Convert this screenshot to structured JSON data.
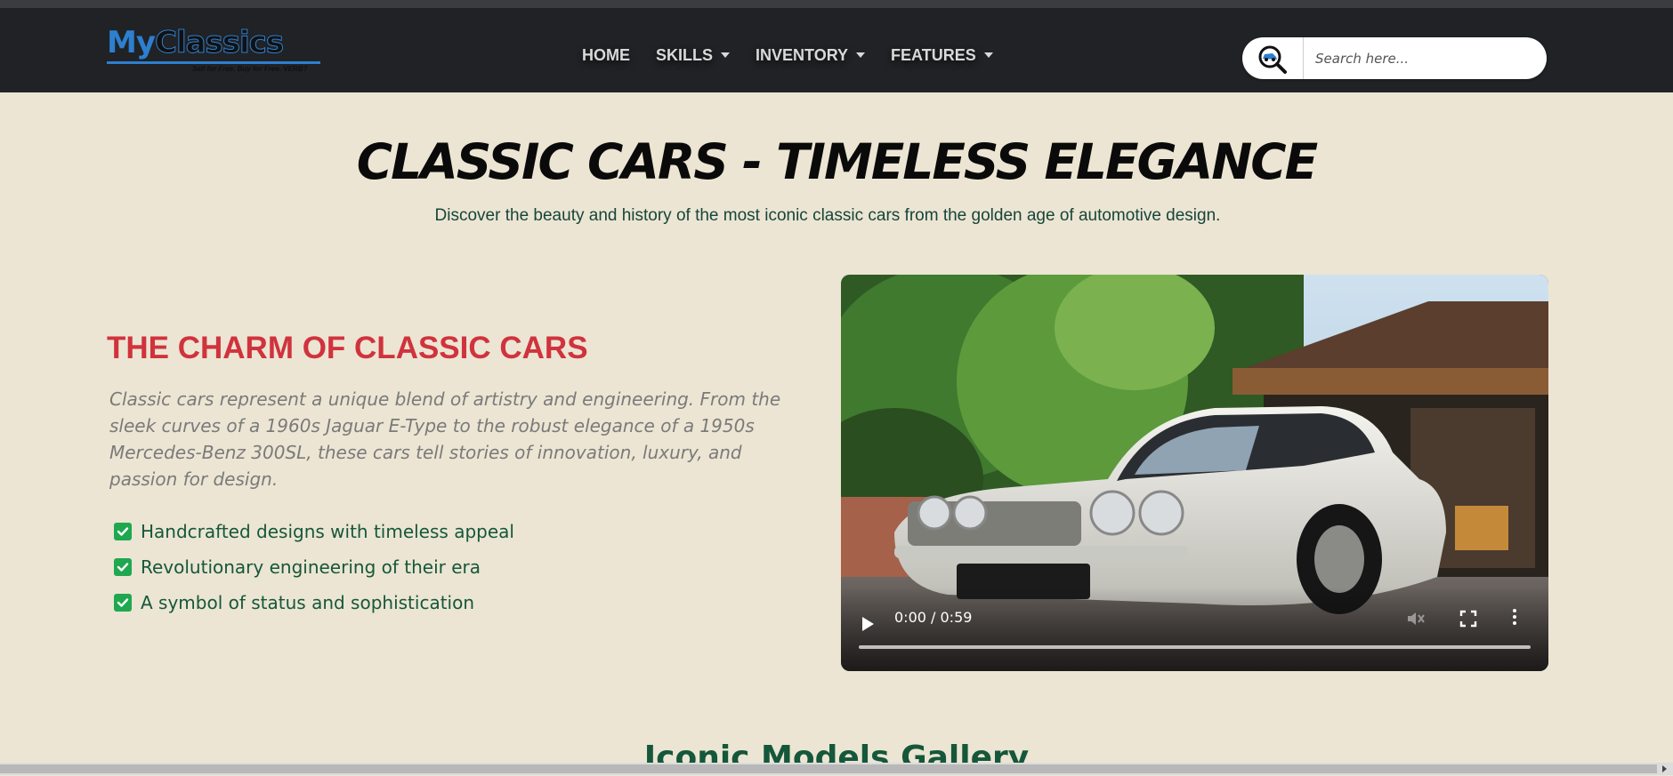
{
  "brand": {
    "name_part1": "My",
    "name_part2": "Classics",
    "tagline": "Sell for Free. Buy for Free. VERB?"
  },
  "nav": {
    "items": [
      {
        "label": "HOME",
        "has_dropdown": false
      },
      {
        "label": "SKILLS",
        "has_dropdown": true
      },
      {
        "label": "INVENTORY",
        "has_dropdown": true
      },
      {
        "label": "FEATURES",
        "has_dropdown": true
      }
    ]
  },
  "search": {
    "placeholder": "Search here...",
    "value": "",
    "icon": "search-car-icon"
  },
  "hero": {
    "title": "CLASSIC CARS - TIMELESS ELEGANCE",
    "subtitle": "Discover the beauty and history of the most iconic classic cars from the golden age of automotive design."
  },
  "charm": {
    "title": "THE CHARM OF CLASSIC CARS",
    "body": "Classic cars represent a unique blend of artistry and engineering. From the sleek curves of a 1960s Jaguar E-Type to the robust elegance of a 1950s Mercedes-Benz 300SL, these cars tell stories of innovation, luxury, and passion for design.",
    "checklist": [
      "Handcrafted designs with timeless appeal",
      "Revolutionary engineering of their era",
      "A symbol of status and sophistication"
    ]
  },
  "video": {
    "time_display": "0:00 / 0:59",
    "progress": 0,
    "controls": [
      "play-icon",
      "mute-icon",
      "fullscreen-icon",
      "more-options-icon"
    ]
  },
  "gallery": {
    "title": "Iconic Models Gallery"
  },
  "colors": {
    "nav_bg": "#202225",
    "page_bg": "#ece5d3",
    "accent_red": "#d0333d",
    "accent_green": "#15573a",
    "check_green": "#1fa84f",
    "brand_blue": "#2d7fd0"
  }
}
